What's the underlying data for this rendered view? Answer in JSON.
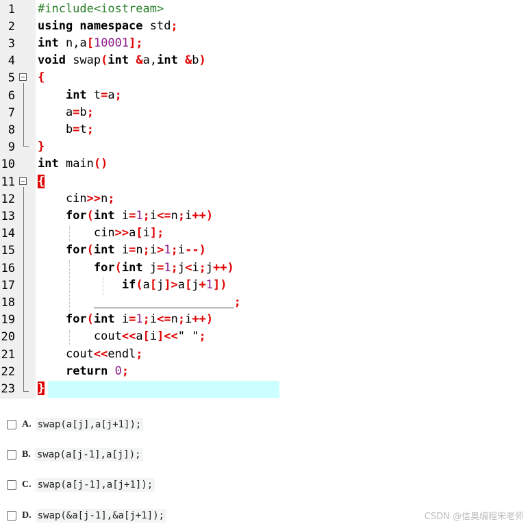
{
  "lines": [
    {
      "n": "1",
      "tokens": [
        {
          "t": "#include<iostream>",
          "c": "pp"
        }
      ]
    },
    {
      "n": "2",
      "tokens": [
        {
          "t": "using namespace ",
          "c": "kw"
        },
        {
          "t": "std",
          "c": ""
        },
        {
          "t": ";",
          "c": "op"
        }
      ]
    },
    {
      "n": "3",
      "tokens": [
        {
          "t": "int ",
          "c": "kw"
        },
        {
          "t": "n",
          "c": ""
        },
        {
          "t": ",",
          "c": ""
        },
        {
          "t": "a",
          "c": ""
        },
        {
          "t": "[",
          "c": "op"
        },
        {
          "t": "10001",
          "c": "num"
        },
        {
          "t": "];",
          "c": "op"
        }
      ]
    },
    {
      "n": "4",
      "tokens": [
        {
          "t": "void ",
          "c": "kw"
        },
        {
          "t": "swap",
          "c": ""
        },
        {
          "t": "(",
          "c": "op"
        },
        {
          "t": "int ",
          "c": "kw"
        },
        {
          "t": "&",
          "c": "op"
        },
        {
          "t": "a",
          "c": ""
        },
        {
          "t": ",",
          "c": ""
        },
        {
          "t": "int ",
          "c": "kw"
        },
        {
          "t": "&",
          "c": "op"
        },
        {
          "t": "b",
          "c": ""
        },
        {
          "t": ")",
          "c": "op"
        }
      ]
    },
    {
      "n": "5",
      "tokens": [
        {
          "t": "{",
          "c": "op"
        }
      ]
    },
    {
      "n": "6",
      "tokens": [
        {
          "t": "    ",
          "c": ""
        },
        {
          "t": "int ",
          "c": "kw"
        },
        {
          "t": "t",
          "c": ""
        },
        {
          "t": "=",
          "c": "op"
        },
        {
          "t": "a",
          "c": ""
        },
        {
          "t": ";",
          "c": "op"
        }
      ]
    },
    {
      "n": "7",
      "tokens": [
        {
          "t": "    a",
          "c": ""
        },
        {
          "t": "=",
          "c": "op"
        },
        {
          "t": "b",
          "c": ""
        },
        {
          "t": ";",
          "c": "op"
        }
      ]
    },
    {
      "n": "8",
      "tokens": [
        {
          "t": "    b",
          "c": ""
        },
        {
          "t": "=",
          "c": "op"
        },
        {
          "t": "t",
          "c": ""
        },
        {
          "t": ";",
          "c": "op"
        }
      ]
    },
    {
      "n": "9",
      "tokens": [
        {
          "t": "}",
          "c": "op"
        }
      ]
    },
    {
      "n": "10",
      "tokens": [
        {
          "t": "int ",
          "c": "kw"
        },
        {
          "t": "main",
          "c": ""
        },
        {
          "t": "()",
          "c": "op"
        }
      ]
    },
    {
      "n": "11",
      "tokens": [
        {
          "t": "{",
          "c": "brace-hl"
        }
      ]
    },
    {
      "n": "12",
      "tokens": [
        {
          "t": "    cin",
          "c": ""
        },
        {
          "t": ">>",
          "c": "op"
        },
        {
          "t": "n",
          "c": ""
        },
        {
          "t": ";",
          "c": "op"
        }
      ]
    },
    {
      "n": "13",
      "tokens": [
        {
          "t": "    ",
          "c": ""
        },
        {
          "t": "for",
          "c": "kw"
        },
        {
          "t": "(",
          "c": "op"
        },
        {
          "t": "int ",
          "c": "kw"
        },
        {
          "t": "i",
          "c": ""
        },
        {
          "t": "=",
          "c": "op"
        },
        {
          "t": "1",
          "c": "num"
        },
        {
          "t": ";",
          "c": "op"
        },
        {
          "t": "i",
          "c": ""
        },
        {
          "t": "<=",
          "c": "op"
        },
        {
          "t": "n",
          "c": ""
        },
        {
          "t": ";",
          "c": "op"
        },
        {
          "t": "i",
          "c": ""
        },
        {
          "t": "++)",
          "c": "op"
        }
      ]
    },
    {
      "n": "14",
      "tokens": [
        {
          "t": "        cin",
          "c": ""
        },
        {
          "t": ">>",
          "c": "op"
        },
        {
          "t": "a",
          "c": ""
        },
        {
          "t": "[",
          "c": "op"
        },
        {
          "t": "i",
          "c": ""
        },
        {
          "t": "];",
          "c": "op"
        }
      ]
    },
    {
      "n": "15",
      "tokens": [
        {
          "t": "    ",
          "c": ""
        },
        {
          "t": "for",
          "c": "kw"
        },
        {
          "t": "(",
          "c": "op"
        },
        {
          "t": "int ",
          "c": "kw"
        },
        {
          "t": "i",
          "c": ""
        },
        {
          "t": "=",
          "c": "op"
        },
        {
          "t": "n",
          "c": ""
        },
        {
          "t": ";",
          "c": "op"
        },
        {
          "t": "i",
          "c": ""
        },
        {
          "t": ">",
          "c": "op"
        },
        {
          "t": "1",
          "c": "num"
        },
        {
          "t": ";",
          "c": "op"
        },
        {
          "t": "i",
          "c": ""
        },
        {
          "t": "--)",
          "c": "op"
        }
      ]
    },
    {
      "n": "16",
      "tokens": [
        {
          "t": "        ",
          "c": ""
        },
        {
          "t": "for",
          "c": "kw"
        },
        {
          "t": "(",
          "c": "op"
        },
        {
          "t": "int ",
          "c": "kw"
        },
        {
          "t": "j",
          "c": ""
        },
        {
          "t": "=",
          "c": "op"
        },
        {
          "t": "1",
          "c": "num"
        },
        {
          "t": ";",
          "c": "op"
        },
        {
          "t": "j",
          "c": ""
        },
        {
          "t": "<",
          "c": "op"
        },
        {
          "t": "i",
          "c": ""
        },
        {
          "t": ";",
          "c": "op"
        },
        {
          "t": "j",
          "c": ""
        },
        {
          "t": "++)",
          "c": "op"
        }
      ]
    },
    {
      "n": "17",
      "tokens": [
        {
          "t": "            ",
          "c": ""
        },
        {
          "t": "if",
          "c": "kw"
        },
        {
          "t": "(",
          "c": "op"
        },
        {
          "t": "a",
          "c": ""
        },
        {
          "t": "[",
          "c": "op"
        },
        {
          "t": "j",
          "c": ""
        },
        {
          "t": "]>",
          "c": "op"
        },
        {
          "t": "a",
          "c": ""
        },
        {
          "t": "[",
          "c": "op"
        },
        {
          "t": "j",
          "c": ""
        },
        {
          "t": "+",
          "c": "op"
        },
        {
          "t": "1",
          "c": "num"
        },
        {
          "t": "])",
          "c": "op"
        }
      ]
    },
    {
      "n": "18",
      "tokens": [
        {
          "t": "        ____________________",
          "c": ""
        },
        {
          "t": ";",
          "c": "op"
        }
      ]
    },
    {
      "n": "19",
      "tokens": [
        {
          "t": "    ",
          "c": ""
        },
        {
          "t": "for",
          "c": "kw"
        },
        {
          "t": "(",
          "c": "op"
        },
        {
          "t": "int ",
          "c": "kw"
        },
        {
          "t": "i",
          "c": ""
        },
        {
          "t": "=",
          "c": "op"
        },
        {
          "t": "1",
          "c": "num"
        },
        {
          "t": ";",
          "c": "op"
        },
        {
          "t": "i",
          "c": ""
        },
        {
          "t": "<=",
          "c": "op"
        },
        {
          "t": "n",
          "c": ""
        },
        {
          "t": ";",
          "c": "op"
        },
        {
          "t": "i",
          "c": ""
        },
        {
          "t": "++)",
          "c": "op"
        }
      ]
    },
    {
      "n": "20",
      "tokens": [
        {
          "t": "        cout",
          "c": ""
        },
        {
          "t": "<<",
          "c": "op"
        },
        {
          "t": "a",
          "c": ""
        },
        {
          "t": "[",
          "c": "op"
        },
        {
          "t": "i",
          "c": ""
        },
        {
          "t": "]<<",
          "c": "op"
        },
        {
          "t": "\" \"",
          "c": "str"
        },
        {
          "t": ";",
          "c": "op"
        }
      ]
    },
    {
      "n": "21",
      "tokens": [
        {
          "t": "    cout",
          "c": ""
        },
        {
          "t": "<<",
          "c": "op"
        },
        {
          "t": "endl",
          "c": ""
        },
        {
          "t": ";",
          "c": "op"
        }
      ]
    },
    {
      "n": "22",
      "tokens": [
        {
          "t": "    ",
          "c": ""
        },
        {
          "t": "return ",
          "c": "kw"
        },
        {
          "t": "0",
          "c": "num"
        },
        {
          "t": ";",
          "c": "op"
        }
      ]
    },
    {
      "n": "23",
      "tokens": [
        {
          "t": "}",
          "c": "brace-hl"
        }
      ]
    }
  ],
  "current_line": "23",
  "fold_markers": [
    "5",
    "11"
  ],
  "options": [
    {
      "letter": "A.",
      "code": "swap(a[j],a[j+1]);"
    },
    {
      "letter": "B.",
      "code": "swap(a[j-1],a[j]);"
    },
    {
      "letter": "C.",
      "code": "swap(a[j-1],a[j+1]);"
    },
    {
      "letter": "D.",
      "code": "swap(&a[j-1],&a[j+1]);"
    }
  ],
  "watermark": "CSDN @信奥编程宋老师",
  "colors": {
    "keyword": "#000000",
    "operator": "#e00000",
    "number": "#8b1a8b",
    "preprocessor": "#2a7f2a",
    "current_line": "#ccffff",
    "gutter": "#f0f0f0"
  }
}
